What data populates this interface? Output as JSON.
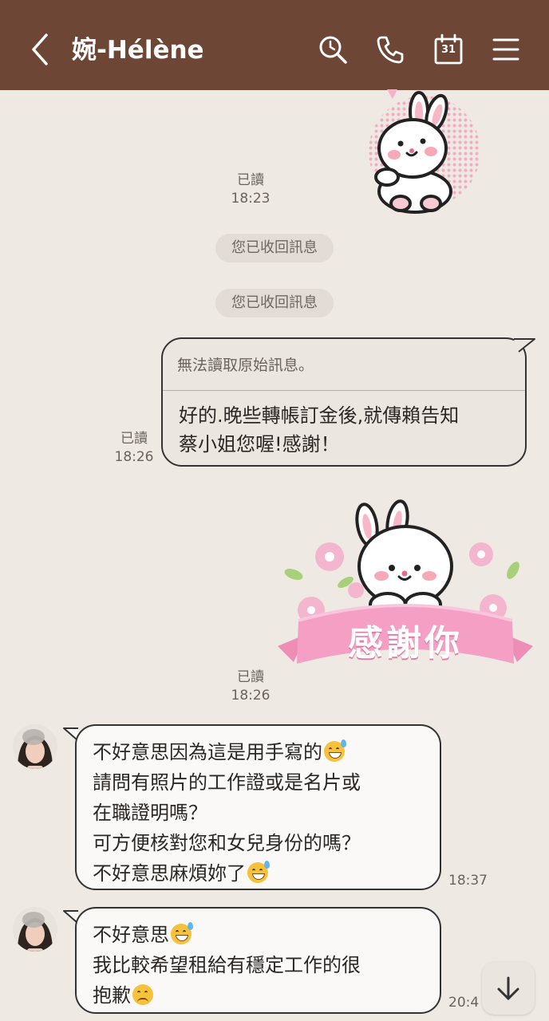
{
  "header": {
    "back_icon": "chevron-left-icon",
    "title": "婉-Hélène",
    "icons": [
      "search-icon",
      "phone-icon",
      "calendar-icon",
      "menu-icon"
    ],
    "calendar_day": "31",
    "background_color": "#6d4636"
  },
  "messages": {
    "sticker1_read": "已讀",
    "sticker1_time": "18:23",
    "system1": "您已收回訊息",
    "system2": "您已收回訊息",
    "quote_original": "無法讀取原始訊息。",
    "quote_reply_line1": "好的.晚些轉帳訂金後,就傳賴告知",
    "quote_reply_line2": "蔡小姐您喔!感謝！",
    "quote_read": "已讀",
    "quote_time": "18:26",
    "sticker2_text": "感謝你",
    "sticker2_read": "已讀",
    "sticker2_time": "18:26",
    "recv1_lines": [
      "不好意思因為這是用手寫的",
      "請問有照片的工作證或是名片或",
      "在職證明嗎？",
      "可方便核對您和女兒身份的嗎？",
      "不好意思麻煩妳了"
    ],
    "recv1_time": "18:37",
    "recv2_lines": [
      "不好意思",
      "我比較希望租給有穩定工作的很",
      "抱歉"
    ],
    "recv2_time": "20:4"
  },
  "scroll_button_icon": "arrow-down-icon"
}
